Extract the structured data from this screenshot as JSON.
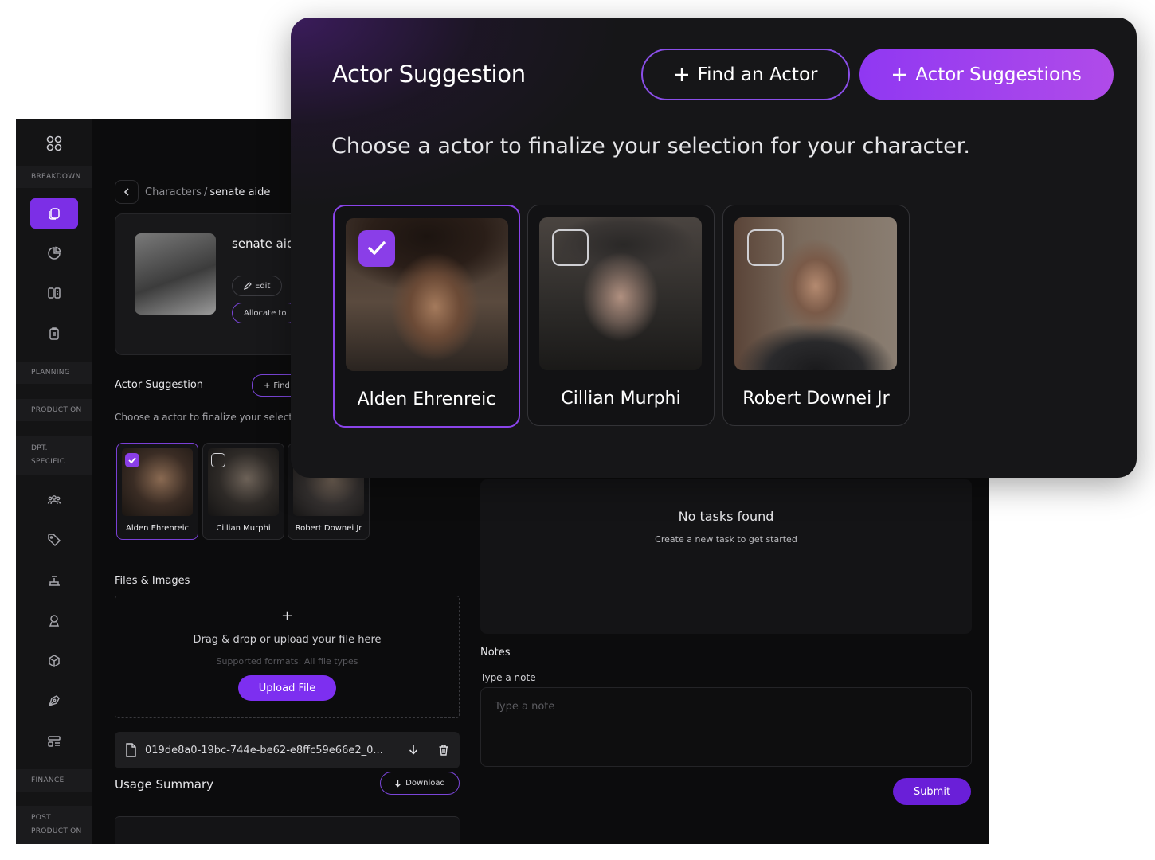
{
  "sidebar": {
    "sections": [
      "BREAKDOWN",
      "PLANNING",
      "PRODUCTION",
      "DPT. SPECIFIC",
      "FINANCE",
      "POST PRODUCTION"
    ]
  },
  "breadcrumb": {
    "parent": "Characters",
    "separator": "/",
    "current": "senate aide"
  },
  "character": {
    "name": "senate aide",
    "edit_label": "Edit",
    "allocate_label": "Allocate to"
  },
  "actor_suggestion_small": {
    "title": "Actor Suggestion",
    "find_label": "Find",
    "subtitle": "Choose a actor to finalize your selectio"
  },
  "actors": [
    {
      "name": "Alden Ehrenreic",
      "selected": true
    },
    {
      "name": "Cillian Murphi",
      "selected": false
    },
    {
      "name": "Robert Downei Jr",
      "selected": false
    }
  ],
  "files": {
    "title": "Files & Images",
    "plus": "+",
    "drop_text": "Drag & drop or upload your file here",
    "formats": "Supported formats: All file types",
    "upload_label": "Upload File",
    "file_name": "019de8a0-19bc-744e-be62-e8ffc59e66e2_0..."
  },
  "usage": {
    "title": "Usage Summary",
    "download_label": "Download"
  },
  "tasks": {
    "empty_title": "No tasks found",
    "empty_sub": "Create a new task to get started"
  },
  "notes": {
    "title": "Notes",
    "label": "Type a note",
    "placeholder": "Type a note",
    "submit_label": "Submit"
  },
  "modal": {
    "title": "Actor Suggestion",
    "find_actor_label": "Find an Actor",
    "actor_suggestions_label": "Actor Suggestions",
    "subtitle": "Choose a actor to finalize your selection for your character."
  },
  "colors": {
    "accent": "#8a3ee8",
    "background": "#0c0c0d",
    "modal": "#161618"
  }
}
